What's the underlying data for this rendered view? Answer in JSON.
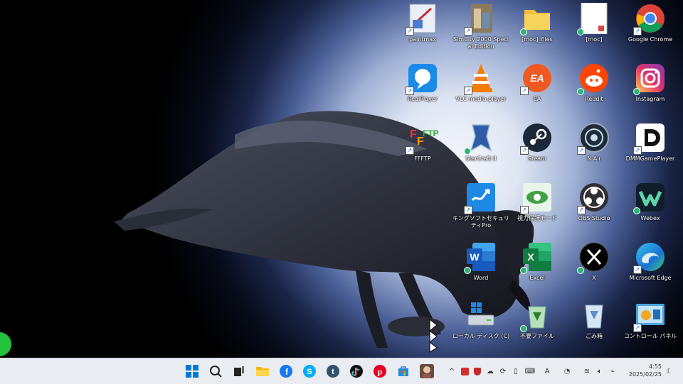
{
  "desktop": {
    "icons": [
      {
        "id": "paintmax",
        "label": "paintmax"
      },
      {
        "id": "simcity",
        "label": "SimCity 2000 Special Edition"
      },
      {
        "id": "moc-files",
        "label": "[moc]_files"
      },
      {
        "id": "moc",
        "label": "[moc]"
      },
      {
        "id": "chrome",
        "label": "Google Chrome"
      },
      {
        "id": "realplayer",
        "label": "RealPlayer"
      },
      {
        "id": "vlc",
        "label": "VLC media player"
      },
      {
        "id": "ea",
        "label": "EA"
      },
      {
        "id": "reddit",
        "label": "Reddit"
      },
      {
        "id": "instagram",
        "label": "Instagram"
      },
      {
        "id": "ffftp",
        "label": "FFFTP"
      },
      {
        "id": "starcraft",
        "label": "StarCraft II"
      },
      {
        "id": "steam",
        "label": "Steam"
      },
      {
        "id": "nair",
        "label": "N Air"
      },
      {
        "id": "dmm",
        "label": "DMMGamePlayer"
      },
      {
        "id": "kingsoft",
        "label": "キングソフトセキュリティPro"
      },
      {
        "id": "eyecare",
        "label": "視力保護モード"
      },
      {
        "id": "obs",
        "label": "OBS Studio"
      },
      {
        "id": "webex",
        "label": "Webex"
      },
      {
        "id": "word",
        "label": "Word"
      },
      {
        "id": "excel",
        "label": "Excel"
      },
      {
        "id": "x",
        "label": "X"
      },
      {
        "id": "edge",
        "label": "Microsoft Edge"
      },
      {
        "id": "localdisk",
        "label": "ローカル ディスク (C)"
      },
      {
        "id": "unneeded",
        "label": "不要ファイル"
      },
      {
        "id": "recycle",
        "label": "ごみ箱"
      },
      {
        "id": "control",
        "label": "コントロール パネル"
      }
    ]
  },
  "taskbar": {
    "apps": [
      "start",
      "search",
      "task-view",
      "file-explorer",
      "facebook",
      "skype",
      "tumblr",
      "tiktok",
      "pinterest",
      "store",
      "avatar-app"
    ],
    "tray": {
      "ime_mode": "A"
    },
    "clock": {
      "time": "4:55",
      "date": "2025/02/25"
    }
  },
  "colors": {
    "taskbar": "#e9ecf1",
    "accent": "#0067c0"
  }
}
